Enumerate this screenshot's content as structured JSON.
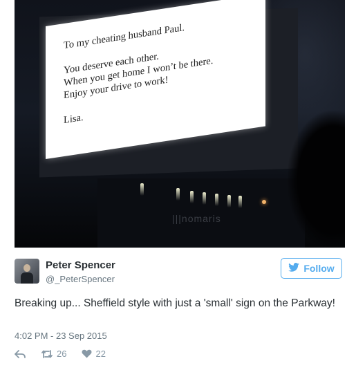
{
  "photo": {
    "billboard_lines": [
      "To my cheating husband Paul.",
      "You deserve each other.",
      "When you get home I won’t be there.",
      "Enjoy your drive to work!",
      "Lisa."
    ]
  },
  "tweet": {
    "author_name": "Peter Spencer",
    "author_handle": "@_PeterSpencer",
    "follow_label": "Follow",
    "text": "Breaking up... Sheffield style with just a 'small' sign on the Parkway!",
    "timestamp": "4:02 PM - 23 Sep 2015",
    "retweets": "26",
    "likes": "22"
  },
  "icons": {
    "follow": "twitter-bird-icon",
    "reply": "reply-icon",
    "retweet": "retweet-icon",
    "like": "heart-icon"
  },
  "colors": {
    "accent": "#55acee",
    "text": "#292f33",
    "muted": "#66757f",
    "action": "#8899a6"
  }
}
